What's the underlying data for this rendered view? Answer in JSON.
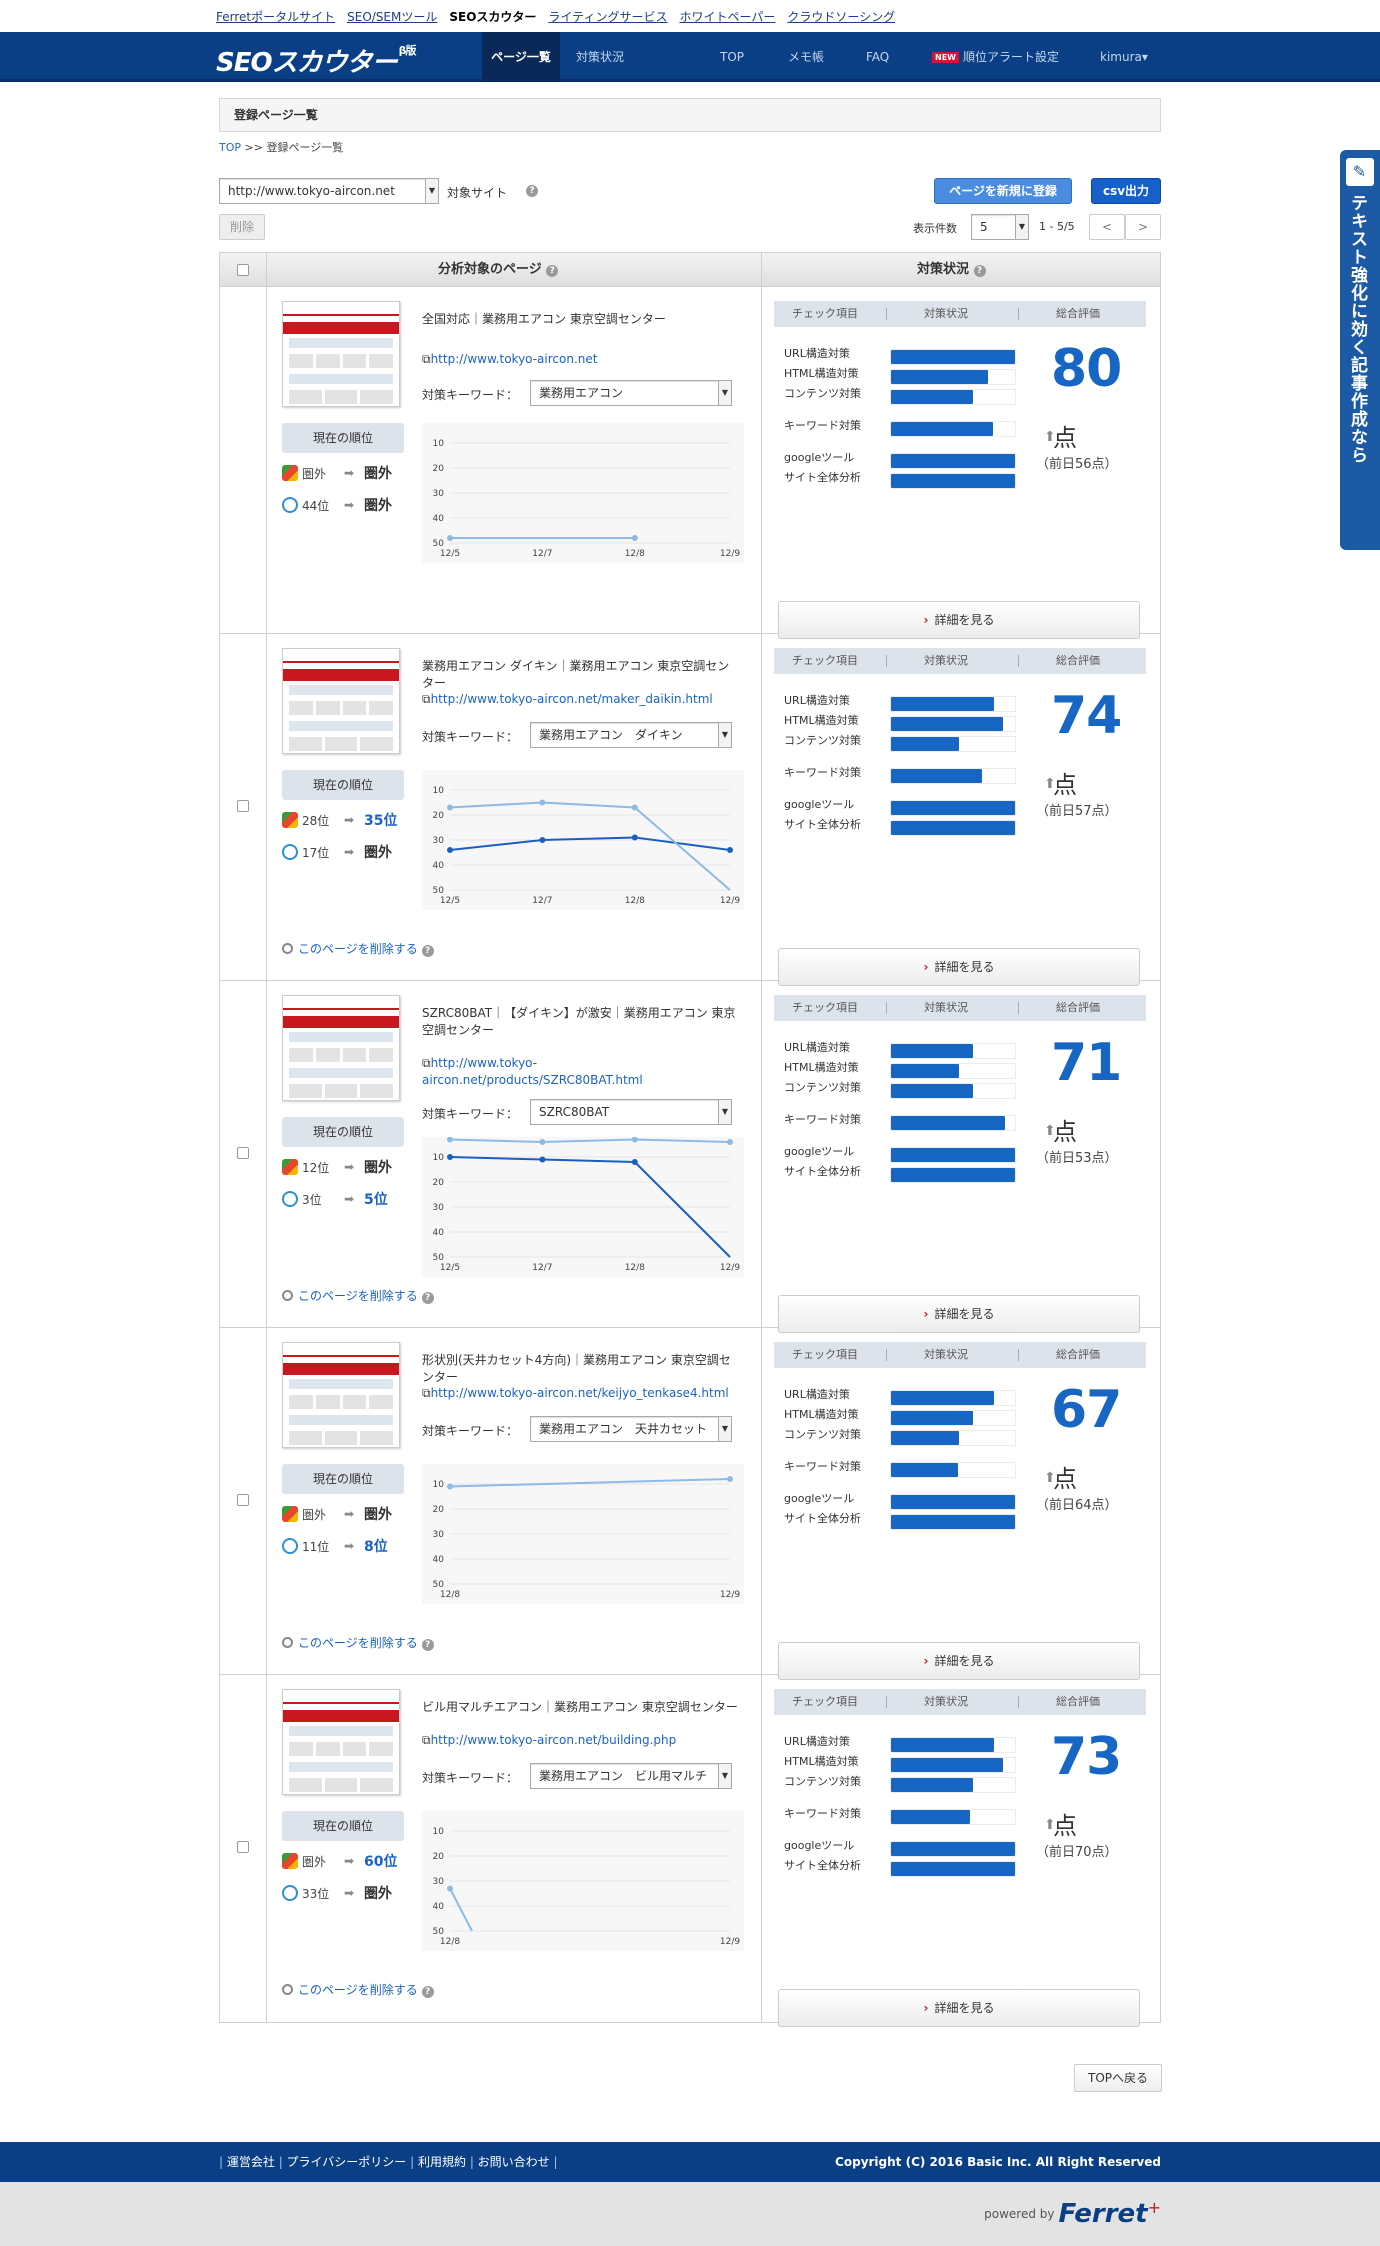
{
  "top_links": [
    "Ferretポータルサイト",
    "SEO/SEMツール",
    "SEOスカウター",
    "ライティングサービス",
    "ホワイトペーパー",
    "クラウドソーシング"
  ],
  "nav": {
    "logo": "SEOスカウター",
    "logo_badge": "β版",
    "items": [
      "ページ一覧",
      "対策状況",
      "TOP",
      "メモ帳",
      "FAQ"
    ],
    "new_badge": "NEW",
    "alert": "順位アラート設定",
    "user": "kimura▾"
  },
  "page_title": "登録ページ一覧",
  "breadcrumb": {
    "top": "TOP",
    "sep": " >> ",
    "current": "登録ページ一覧"
  },
  "site_select": {
    "value": "http://www.tokyo-aircon.net",
    "label": "対象サイト"
  },
  "buttons": {
    "register": "ページを新規に登録",
    "csv": "csv出力",
    "delete": "削除",
    "detail": "詳細を見る",
    "delete_page": "このページを削除する",
    "back_top": "TOPへ戻る"
  },
  "paging": {
    "label": "表示件数",
    "per_page": "5",
    "range": "1 - 5/5",
    "prev": "<",
    "next": ">"
  },
  "table_head": {
    "page": "分析対象のページ",
    "status": "対策状況"
  },
  "labels": {
    "current_rank": "現在の順位",
    "keyword": "対策キーワード：",
    "check_item": "チェック項目",
    "status": "対策状況",
    "overall": "総合評価",
    "pt": "点"
  },
  "check_items": [
    "URL構造対策",
    "HTML構造対策",
    "コンテンツ対策",
    "キーワード対策",
    "googleツール",
    "サイト全体分析"
  ],
  "colors": {
    "nav": "#0a3f86",
    "accent": "#1766c4",
    "bar": "#1766c4",
    "series_google": "#1a5fc0",
    "series_yahoo": "#8dbbe3"
  },
  "rows": [
    {
      "title": "全国対応｜業務用エアコン 東京空調センター",
      "url": "http://www.tokyo-aircon.net",
      "keyword": "業務用エアコン",
      "google": {
        "from": "圏外",
        "to": "圏外"
      },
      "yahoo": {
        "from": "44位",
        "to": "圏外"
      },
      "score": "80",
      "prev": "（前日56点）",
      "bars": [
        1.0,
        0.78,
        0.66,
        0.82,
        1.0,
        1.0
      ],
      "chart": {
        "type": "line",
        "x": [
          "12/5",
          "12/7",
          "12/8",
          "12/9"
        ],
        "yticks": [
          "10",
          "20",
          "30",
          "40",
          "50"
        ],
        "ylim": [
          50,
          10
        ],
        "series": [
          {
            "values": [
              48,
              null,
              48,
              null
            ]
          }
        ]
      }
    },
    {
      "title": "業務用エアコン ダイキン｜業務用エアコン 東京空調センター",
      "url": "http://www.tokyo-aircon.net/maker_daikin.html",
      "keyword": "業務用エアコン　ダイキン",
      "google": {
        "from": "28位",
        "to": "35位"
      },
      "yahoo": {
        "from": "17位",
        "to": "圏外"
      },
      "score": "74",
      "prev": "（前日57点）",
      "bars": [
        0.83,
        0.9,
        0.55,
        0.73,
        1.0,
        1.0
      ],
      "chart": {
        "type": "line",
        "x": [
          "12/5",
          "12/7",
          "12/8",
          "12/9"
        ],
        "yticks": [
          "10",
          "20",
          "30",
          "40",
          "50"
        ],
        "ylim": [
          50,
          10
        ],
        "series": [
          {
            "values": [
              34,
              30,
              29,
              34
            ]
          },
          {
            "values": [
              17,
              15,
              17,
              50
            ]
          }
        ]
      }
    },
    {
      "title": "SZRC80BAT｜【ダイキン】が激安｜業務用エアコン 東京空調センター",
      "url": "http://www.tokyo-aircon.net/products/SZRC80BAT.html",
      "keyword": "SZRC80BAT",
      "google": {
        "from": "12位",
        "to": "圏外"
      },
      "yahoo": {
        "from": "3位",
        "to": "5位"
      },
      "score": "71",
      "prev": "（前日53点）",
      "bars": [
        0.66,
        0.55,
        0.66,
        0.92,
        1.0,
        1.0
      ],
      "chart": {
        "type": "line",
        "x": [
          "12/5",
          "12/7",
          "12/8",
          "12/9"
        ],
        "yticks": [
          "10",
          "20",
          "30",
          "40",
          "50"
        ],
        "ylim": [
          50,
          10
        ],
        "series": [
          {
            "values": [
              10,
              11,
              12,
              50
            ]
          },
          {
            "values": [
              3,
              4,
              3,
              4
            ]
          }
        ]
      }
    },
    {
      "title": "形状別(天井カセット4方向)｜業務用エアコン 東京空調センター",
      "url": "http://www.tokyo-aircon.net/keijyo_tenkase4.html",
      "keyword": "業務用エアコン　天井カセット",
      "google": {
        "from": "圏外",
        "to": "圏外"
      },
      "yahoo": {
        "from": "11位",
        "to": "8位"
      },
      "score": "67",
      "prev": "（前日64点）",
      "bars": [
        0.83,
        0.66,
        0.55,
        0.54,
        1.0,
        1.0
      ],
      "chart": {
        "type": "line",
        "x": [
          "12/8",
          "12/9"
        ],
        "yticks": [
          "10",
          "20",
          "30",
          "40",
          "50"
        ],
        "ylim": [
          50,
          10
        ],
        "series": [
          {
            "values": [
              11,
              8
            ]
          }
        ]
      }
    },
    {
      "title": "ビル用マルチエアコン｜業務用エアコン 東京空調センター",
      "url": "http://www.tokyo-aircon.net/building.php",
      "keyword": "業務用エアコン　ビル用マルチ",
      "google": {
        "from": "圏外",
        "to": "60位"
      },
      "yahoo": {
        "from": "33位",
        "to": "圏外"
      },
      "score": "73",
      "prev": "（前日70点）",
      "bars": [
        0.83,
        0.9,
        0.66,
        0.64,
        1.0,
        1.0
      ],
      "chart": {
        "type": "line",
        "x": [
          "12/8",
          "12/9"
        ],
        "yticks": [
          "10",
          "20",
          "30",
          "40",
          "50"
        ],
        "ylim": [
          50,
          10
        ],
        "series": [
          {
            "values": [
              33,
              null
            ]
          }
        ]
      }
    }
  ],
  "footer": {
    "links": [
      "運営会社",
      "プライバシーポリシー",
      "利用規約",
      "お問い合わせ"
    ],
    "copyright": "Copyright (C) 2016 Basic Inc. All Right Reserved",
    "powered": "powered by",
    "brand": "Ferret",
    "brand_plus": "+"
  },
  "side_banner": "テキスト強化に効く記事作成なら"
}
